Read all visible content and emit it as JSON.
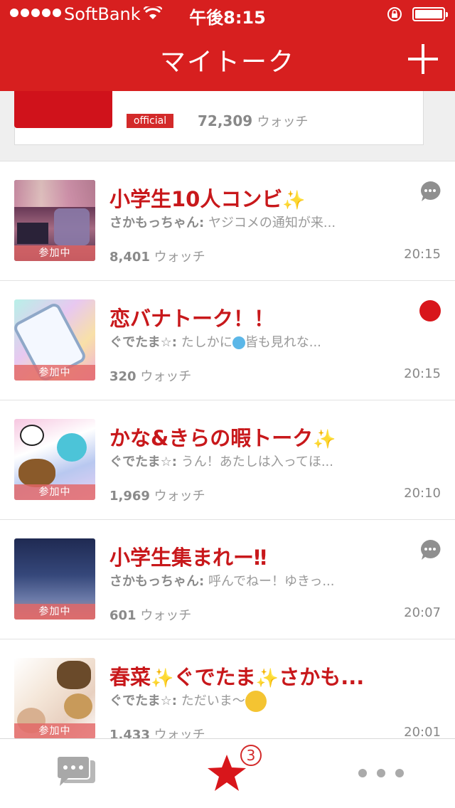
{
  "status_bar": {
    "carrier": "SoftBank",
    "time": "午後8:15"
  },
  "header": {
    "title": "マイトーク"
  },
  "official_card": {
    "badge": "official",
    "count": "72,309",
    "count_unit": "ウォッチ"
  },
  "rooms": [
    {
      "title": "小学生10人コンビ",
      "sender": "さかもっちゃん:",
      "message": "ヤジコメの通知が来...",
      "count": "8,401",
      "count_unit": "ウォッチ",
      "time": "20:15",
      "badge": "参加中",
      "indicator": "comment-icon"
    },
    {
      "title": "恋バナトーク！！",
      "sender": "ぐでたま☆:",
      "message_before": "たしかに",
      "message_after": "皆も見れな...",
      "count": "320",
      "count_unit": "ウォッチ",
      "time": "20:15",
      "badge": "参加中",
      "indicator": "red-dot"
    },
    {
      "title": "かな&きらの暇トーク",
      "sender": "ぐでたま☆:",
      "message": "うん！あたしは入ってほ...",
      "count": "1,969",
      "count_unit": "ウォッチ",
      "time": "20:10",
      "badge": "参加中",
      "indicator": ""
    },
    {
      "title": "小学生集まれー‼",
      "sender": "さかもっちゃん:",
      "message": "呼んでねー！ゆきっ...",
      "count": "601",
      "count_unit": "ウォッチ",
      "time": "20:07",
      "badge": "参加中",
      "indicator": "comment-icon"
    },
    {
      "title_a": "春菜",
      "title_b": "ぐでたま",
      "title_c": "さかも...",
      "sender": "ぐでたま☆:",
      "message": "ただいま〜",
      "count": "1,433",
      "count_unit": "ウォッチ",
      "time": "20:01",
      "badge": "参加中",
      "indicator": ""
    }
  ],
  "tabbar": {
    "badge_count": "3",
    "active_tab": "favorites"
  },
  "colors": {
    "brand_red": "#d71f1f",
    "title_red": "#c8181b",
    "badge_red": "#d32a2a",
    "gray_text": "#999999"
  }
}
